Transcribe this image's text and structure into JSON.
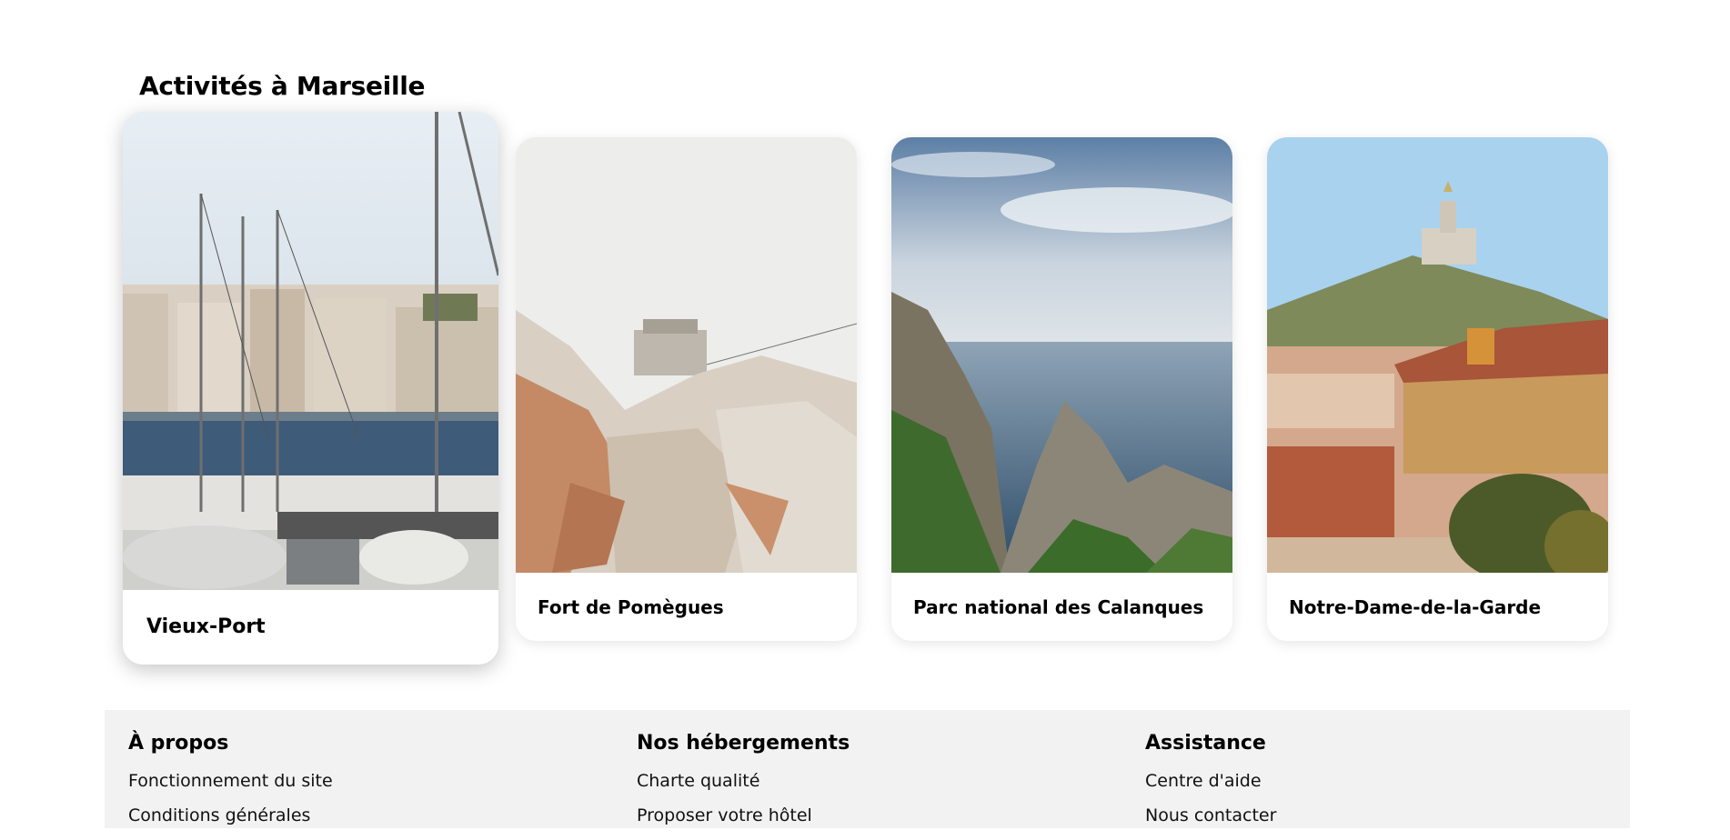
{
  "section": {
    "title": "Activités à Marseille"
  },
  "activities": [
    {
      "label": "Vieux-Port",
      "image": "harbor-boats-photo",
      "hovered": true
    },
    {
      "label": "Fort de Pomègues",
      "image": "fort-on-rocks-photo",
      "hovered": false
    },
    {
      "label": "Parc national des Calanques",
      "image": "calanques-cliffs-sea-photo",
      "hovered": false
    },
    {
      "label": "Notre-Dame-de-la-Garde",
      "image": "basilica-on-hill-photo",
      "hovered": false
    }
  ],
  "footer": {
    "columns": [
      {
        "heading": "À propos",
        "links": [
          "Fonctionnement du site",
          "Conditions générales"
        ]
      },
      {
        "heading": "Nos hébergements",
        "links": [
          "Charte qualité",
          "Proposer votre hôtel"
        ]
      },
      {
        "heading": "Assistance",
        "links": [
          "Centre d'aide",
          "Nous contacter"
        ]
      }
    ]
  },
  "colors": {
    "background": "#ffffff",
    "footer_background": "#f2f2f2",
    "text": "#000000"
  }
}
